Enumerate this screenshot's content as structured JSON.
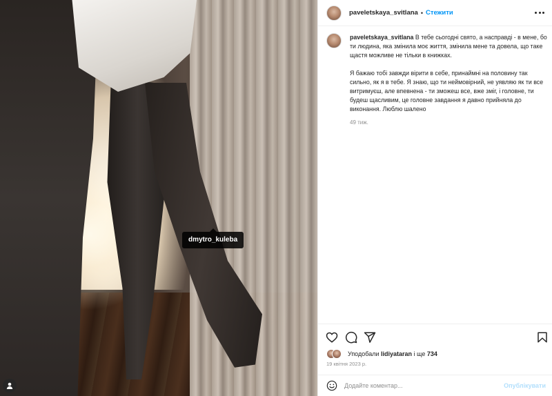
{
  "post": {
    "username": "paveletskaya_svitlana",
    "header_separator": "•",
    "follow_label": "Стежити",
    "photo_tag": "dmytro_kuleba",
    "caption_para1": "В тебе сьогодні свято, а насправді - в мене, бо ти людина, яка змінила моє життя, змінила мене та довела, що таке щастя можливе не тільки в книжках.",
    "caption_para2": "Я бажаю тобі завжди вірити в себе, принаймні на половину так сильно, як я в тебе. Я знаю, що ти неймовірний, не уявляю як ти все витримуєш, але впевнена - ти зможеш все, вже зміг, і головне, ти будеш щасливим, це головне завдання я давно прийняла до виконання. Люблю шалено",
    "caption_time": "49 тиж.",
    "liked_by_prefix": "Уподобали",
    "liked_by_user": "lidiyataran",
    "liked_by_middle": "і ще",
    "liked_by_count": "734",
    "date": "19 квітня 2023 р."
  },
  "comment": {
    "placeholder": "Додайте коментар...",
    "post_label": "Опублікувати"
  },
  "colors": {
    "accent": "#0095f6",
    "post_disabled": "#b2dffc",
    "text": "#262626",
    "muted": "#8e8e8e"
  },
  "icons": [
    "more-options-icon",
    "heart-icon",
    "comment-icon",
    "share-icon",
    "bookmark-icon",
    "emoji-icon",
    "user-tag-icon"
  ]
}
